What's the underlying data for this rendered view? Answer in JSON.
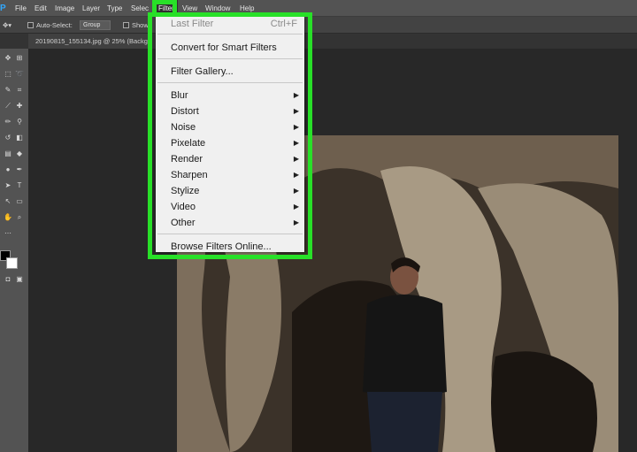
{
  "menubar": {
    "logo": "Ps",
    "items": [
      "File",
      "Edit",
      "Image",
      "Layer",
      "Type",
      "Selec",
      "Filter",
      "View",
      "Window",
      "Help"
    ]
  },
  "options": {
    "auto_select_label": "Auto-Select:",
    "auto_select_value": "Group",
    "show_label": "Show"
  },
  "tab": {
    "title": "20190815_155134.jpg @ 25% (Backg"
  },
  "filter_menu": {
    "last_filter": "Last Filter",
    "last_filter_shortcut": "Ctrl+F",
    "convert_smart": "Convert for Smart Filters",
    "filter_gallery": "Filter Gallery...",
    "submenus": [
      "Blur",
      "Distort",
      "Noise",
      "Pixelate",
      "Render",
      "Sharpen",
      "Stylize",
      "Video",
      "Other"
    ],
    "browse_online": "Browse Filters Online..."
  },
  "colors": {
    "highlight": "#28e028",
    "menubar_bg": "#535353"
  }
}
